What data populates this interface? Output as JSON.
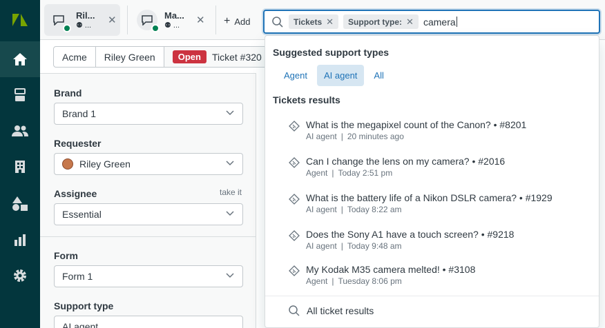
{
  "tabs": [
    {
      "name": "Ril...",
      "sub": " ..."
    },
    {
      "name": "Ma...",
      "sub": " ..."
    }
  ],
  "add_label": "Add",
  "search": {
    "chips": [
      "Tickets",
      "Support type:"
    ],
    "query": "camera"
  },
  "breadcrumb": {
    "org": "Acme",
    "requester": "Riley Green",
    "status": "Open",
    "ticket": "Ticket #320"
  },
  "form": {
    "brand_label": "Brand",
    "brand_value": "Brand 1",
    "requester_label": "Requester",
    "requester_value": "Riley Green",
    "assignee_label": "Assignee",
    "take_it": "take it",
    "assignee_value": "Essential",
    "form_label": "Form",
    "form_value": "Form 1",
    "support_type_label": "Support type",
    "support_type_value": "AI agent"
  },
  "dropdown": {
    "suggested_title": "Suggested support types",
    "pills": [
      "Agent",
      "AI agent",
      "All"
    ],
    "selected_pill": "AI agent",
    "results_title": "Tickets results",
    "results": [
      {
        "title": "What is the megapixel count of the Canon? • #8201",
        "type": "AI agent",
        "time": "20 minutes ago"
      },
      {
        "title": "Can I change the lens on my camera? • #2016",
        "type": "Agent",
        "time": "Today 2:51 pm"
      },
      {
        "title": "What is the battery life of a Nikon DSLR camera? • #1929",
        "type": "AI agent",
        "time": "Today 8:22 am"
      },
      {
        "title": "Does the Sony A1 have a touch screen? • #9218",
        "type": "AI agent",
        "time": "Today 9:48 am"
      },
      {
        "title": "My Kodak M35 camera melted! • #3108",
        "type": "Agent",
        "time": "Tuesday 8:06 pm"
      }
    ],
    "all_results_label": "All ticket results"
  },
  "colors": {
    "nav_bg": "#03363d",
    "accent": "#1f73b7",
    "open_badge": "#cc3340",
    "online": "#038153",
    "logo_green": "#78a300"
  }
}
